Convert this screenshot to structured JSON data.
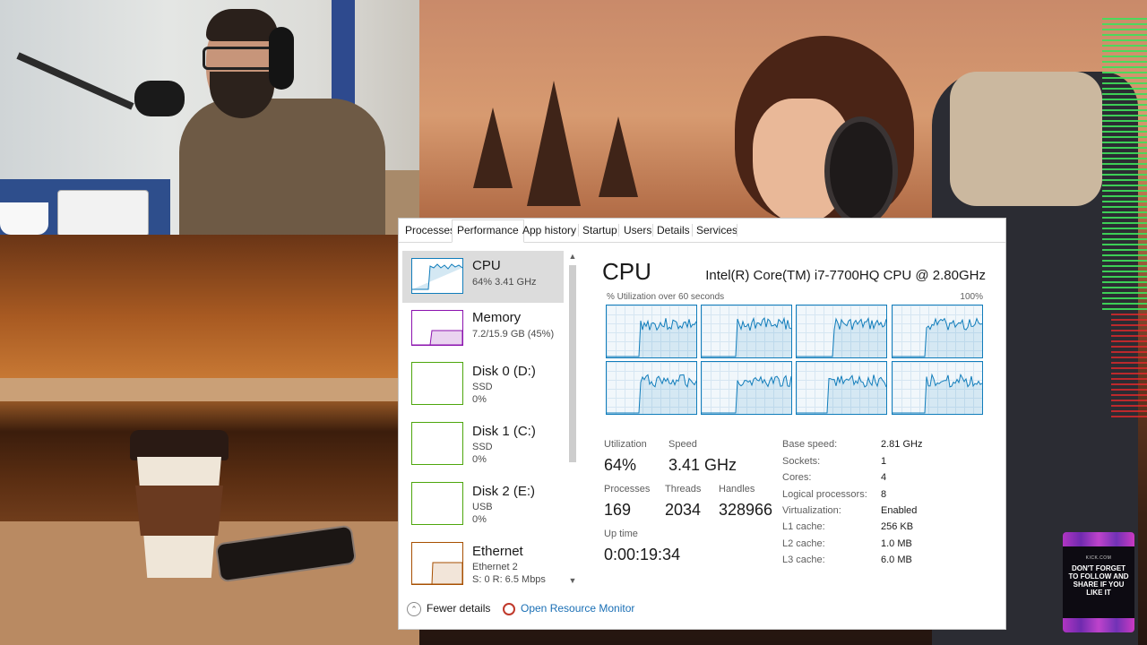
{
  "overlay": {
    "promo_site": "KICK.COM",
    "promo_message": "DON'T FORGET TO FOLLOW AND SHARE IF YOU LIKE IT"
  },
  "taskmanager": {
    "tabs": [
      {
        "label": "Processes"
      },
      {
        "label": "Performance",
        "active": true
      },
      {
        "label": "App history"
      },
      {
        "label": "Startup"
      },
      {
        "label": "Users"
      },
      {
        "label": "Details"
      },
      {
        "label": "Services"
      }
    ],
    "sidebar": [
      {
        "name": "CPU",
        "line1": "64%  3.41 GHz",
        "line2": "",
        "line3": "",
        "color": "#117dbb",
        "selected": true
      },
      {
        "name": "Memory",
        "line1": "7.2/15.9 GB (45%)",
        "line2": "",
        "line3": "",
        "color": "#8b12ae"
      },
      {
        "name": "Disk 0 (D:)",
        "line1": "SSD",
        "line2": "0%",
        "line3": "",
        "color": "#4da60c"
      },
      {
        "name": "Disk 1 (C:)",
        "line1": "SSD",
        "line2": "0%",
        "line3": "",
        "color": "#4da60c"
      },
      {
        "name": "Disk 2 (E:)",
        "line1": "USB",
        "line2": "0%",
        "line3": "",
        "color": "#4da60c"
      },
      {
        "name": "Ethernet",
        "line1": "Ethernet 2",
        "line2": "S: 0  R: 6.5 Mbps",
        "line3": "",
        "color": "#a74f01"
      }
    ],
    "cpu": {
      "title": "CPU",
      "model": "Intel(R) Core(TM) i7-7700HQ CPU @ 2.80GHz",
      "utilization_label": "% Utilization over 60 seconds",
      "utilization_max": "100%",
      "graph_color": "#117dbb",
      "stats": {
        "utilization_label": "Utilization",
        "utilization": "64%",
        "speed_label": "Speed",
        "speed": "3.41 GHz",
        "processes_label": "Processes",
        "processes": "169",
        "threads_label": "Threads",
        "threads": "2034",
        "handles_label": "Handles",
        "handles": "328966",
        "uptime_label": "Up time",
        "uptime": "0:00:19:34"
      },
      "specs": [
        {
          "key": "Base speed:",
          "value": "2.81 GHz"
        },
        {
          "key": "Sockets:",
          "value": "1"
        },
        {
          "key": "Cores:",
          "value": "4"
        },
        {
          "key": "Logical processors:",
          "value": "8"
        },
        {
          "key": "Virtualization:",
          "value": "Enabled"
        },
        {
          "key": "L1 cache:",
          "value": "256 KB"
        },
        {
          "key": "L2 cache:",
          "value": "1.0 MB"
        },
        {
          "key": "L3 cache:",
          "value": "6.0 MB"
        }
      ]
    },
    "footer": {
      "fewer_details": "Fewer details",
      "open_resource_monitor": "Open Resource Monitor"
    }
  }
}
